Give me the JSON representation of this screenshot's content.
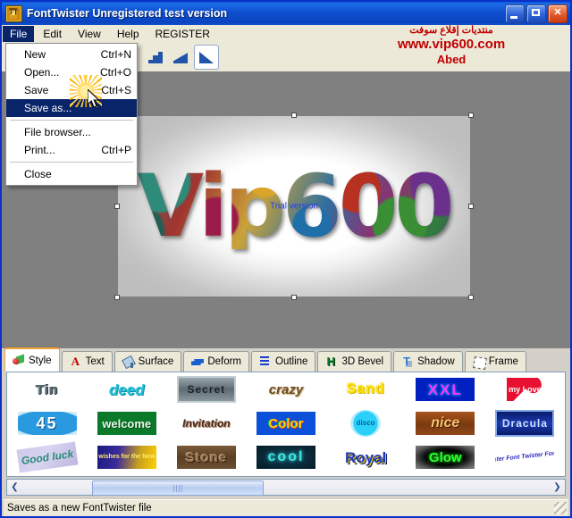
{
  "window": {
    "title": "FontTwister Unregistered test version",
    "icon": "app-icon",
    "minimize": "_",
    "maximize": "□",
    "close": "✕"
  },
  "menubar": {
    "items": [
      {
        "label": "File",
        "active": true
      },
      {
        "label": "Edit",
        "active": false
      },
      {
        "label": "View",
        "active": false
      },
      {
        "label": "Help",
        "active": false
      },
      {
        "label": "REGISTER",
        "active": false
      }
    ]
  },
  "file_menu": {
    "items": [
      {
        "label": "New",
        "accelerator": "Ctrl+N",
        "selected": false
      },
      {
        "label": "Open...",
        "accelerator": "Ctrl+O",
        "selected": false
      },
      {
        "label": "Save",
        "accelerator": "Ctrl+S",
        "selected": false
      },
      {
        "label": "Save as...",
        "accelerator": "",
        "selected": true
      },
      {
        "separator": true
      },
      {
        "label": "File browser...",
        "accelerator": "",
        "selected": false
      },
      {
        "label": "Print...",
        "accelerator": "Ctrl+P",
        "selected": false
      },
      {
        "separator": true
      },
      {
        "label": "Close",
        "accelerator": "",
        "selected": false
      }
    ]
  },
  "toolbar": {
    "buttons": [
      {
        "name": "undo-icon",
        "glyph": "↺"
      },
      {
        "name": "clock-dice-icon",
        "glyph": ""
      },
      {
        "name": "color-circles-icon",
        "glyph": ""
      },
      {
        "name": "fox-icon",
        "glyph": ""
      },
      {
        "name": "magic-wand-icon",
        "glyph": ""
      }
    ],
    "ramps": [
      {
        "name": "gradient-steps-icon",
        "pressed": false
      },
      {
        "name": "gradient-ramp-icon",
        "pressed": false
      },
      {
        "name": "gradient-smooth-icon",
        "pressed": true
      }
    ]
  },
  "watermark": {
    "line1": "منتديات إقلاع سوفت",
    "line2": "www.vip600.com",
    "line3": "Abed",
    "color": "#c00000"
  },
  "canvas": {
    "artwork_text": "Vip600",
    "trial_label": "Trial version",
    "trial_color": "#1a3ef0",
    "background": "#808080"
  },
  "tabs": [
    {
      "label": "Style",
      "icon": "style-cube-icon",
      "active": true
    },
    {
      "label": "Text",
      "icon": "letter-a-icon",
      "active": false
    },
    {
      "label": "Surface",
      "icon": "paint-bucket-icon",
      "active": false
    },
    {
      "label": "Deform",
      "icon": "wave-icon",
      "active": false
    },
    {
      "label": "Outline",
      "icon": "outline-icon",
      "active": false
    },
    {
      "label": "3D Bevel",
      "icon": "bevel-h-icon",
      "active": false
    },
    {
      "label": "Shadow",
      "icon": "shadow-t-icon",
      "active": false
    },
    {
      "label": "Frame",
      "icon": "frame-star-icon",
      "active": false
    }
  ],
  "gallery": {
    "rows": [
      [
        {
          "label": "Tin",
          "style": "s-tin"
        },
        {
          "label": "deed",
          "style": "s-deed"
        },
        {
          "label": "Secret",
          "style": "s-secret"
        },
        {
          "label": "crazy",
          "style": "s-crazy"
        },
        {
          "label": "Sand",
          "style": "s-sand"
        },
        {
          "label": "XXL",
          "style": "s-xxl"
        },
        {
          "label": "my Love",
          "style": "s-love"
        }
      ],
      [
        {
          "label": "45",
          "style": "s-45"
        },
        {
          "label": "welcome",
          "style": "s-welcome"
        },
        {
          "label": "Invitation",
          "style": "s-invit"
        },
        {
          "label": "Color",
          "style": "s-color"
        },
        {
          "label": "disco",
          "style": "s-disco"
        },
        {
          "label": "nice",
          "style": "s-nice"
        },
        {
          "label": "Dracula",
          "style": "s-dracula"
        }
      ],
      [
        {
          "label": "Good luck",
          "style": "s-goodluck"
        },
        {
          "label": "Best wishes for the New Year",
          "style": "s-bestw"
        },
        {
          "label": "Stone",
          "style": "s-stone"
        },
        {
          "label": "cool",
          "style": "s-cool"
        },
        {
          "label": "Royal",
          "style": "s-royal"
        },
        {
          "label": "Glow",
          "style": "s-glow"
        },
        {
          "label": "Font Twister Font Twister Font Twister",
          "style": "s-fontt"
        }
      ]
    ]
  },
  "scrollbar": {
    "left_arrow": "❮",
    "right_arrow": "❯"
  },
  "statusbar": {
    "text": "Saves as a new FontTwister file"
  }
}
